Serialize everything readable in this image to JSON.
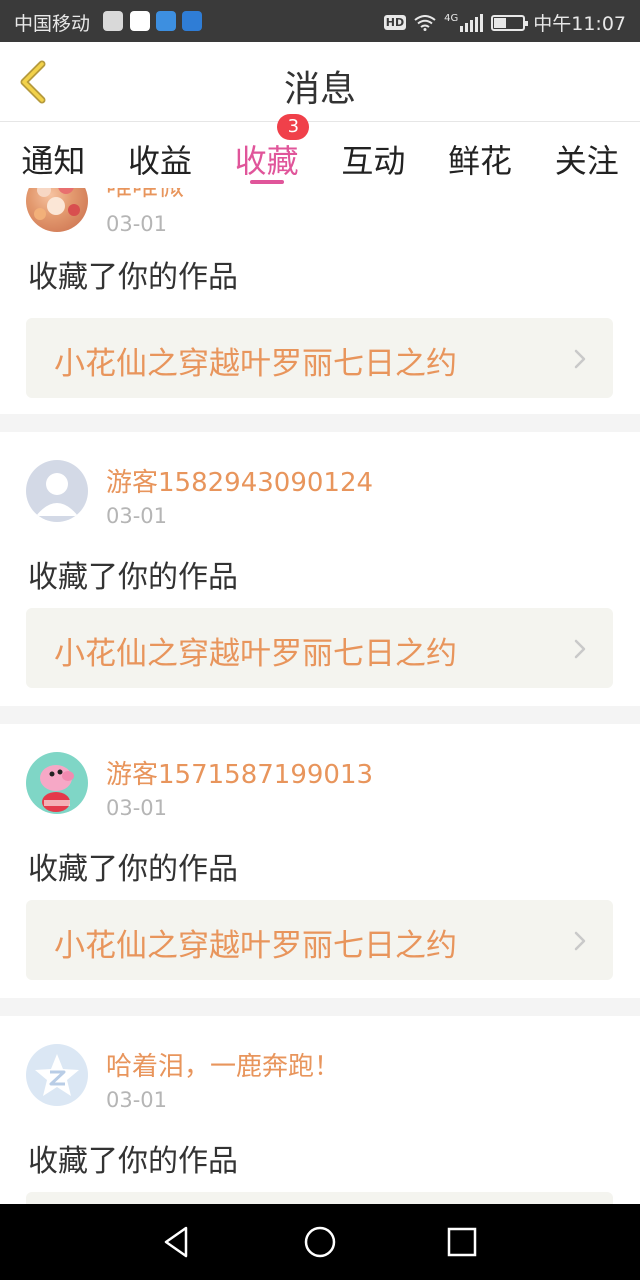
{
  "status_bar": {
    "carrier": "中国移动",
    "network": "4G",
    "hd_label": "HD",
    "time": "中午11:07",
    "icons": [
      "activity-app-icon",
      "browser-app-icon",
      "message-app-icon",
      "weather-app-icon",
      "wifi-icon",
      "signal-icon",
      "battery-icon"
    ]
  },
  "header": {
    "title": "消息",
    "back_icon": "chevron-left-icon"
  },
  "tabs": [
    {
      "label": "通知",
      "active": false
    },
    {
      "label": "收益",
      "active": false
    },
    {
      "label": "收藏",
      "active": true,
      "badge": "3"
    },
    {
      "label": "互动",
      "active": false
    },
    {
      "label": "鲜花",
      "active": false
    },
    {
      "label": "关注",
      "active": false
    }
  ],
  "notifications": [
    {
      "user": "唯唯微",
      "date": "03-01",
      "action": "收藏了你的作品",
      "work": "小花仙之穿越叶罗丽七日之约"
    },
    {
      "user": "游客1582943090124",
      "date": "03-01",
      "action": "收藏了你的作品",
      "work": "小花仙之穿越叶罗丽七日之约"
    },
    {
      "user": "游客1571587199013",
      "date": "03-01",
      "action": "收藏了你的作品",
      "work": "小花仙之穿越叶罗丽七日之约"
    },
    {
      "user": "哈着泪，一鹿奔跑！",
      "date": "03-01",
      "action": "收藏了你的作品",
      "work": ""
    }
  ],
  "nav": {
    "back": "triangle-back-icon",
    "home": "circle-home-icon",
    "recents": "square-recents-icon"
  },
  "colors": {
    "accent": "#e0559a",
    "username": "#e8955c",
    "badge": "#f0404a"
  }
}
